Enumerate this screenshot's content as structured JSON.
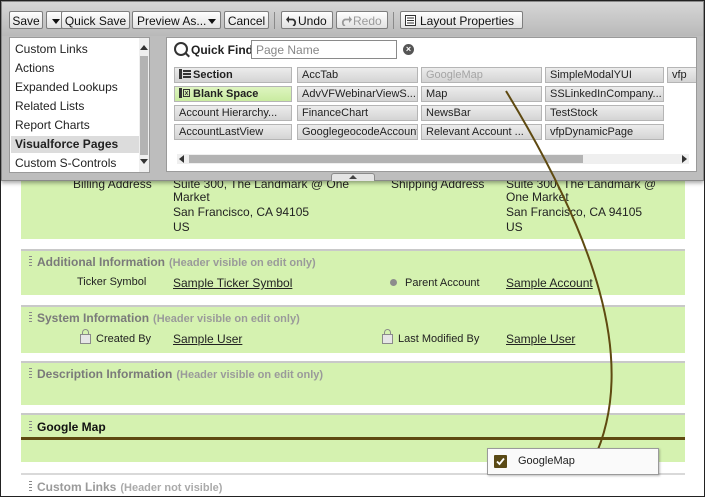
{
  "toolbar": {
    "save": "Save",
    "quick_save": "Quick Save",
    "preview_as": "Preview As...",
    "cancel": "Cancel",
    "undo": "Undo",
    "redo": "Redo",
    "layout_properties": "Layout Properties"
  },
  "categories": {
    "items": [
      "Custom Links",
      "Actions",
      "Expanded Lookups",
      "Related Lists",
      "Report Charts",
      "Visualforce Pages",
      "Custom S-Controls"
    ],
    "selected": "Visualforce Pages"
  },
  "quick_find": {
    "label": "Quick Find",
    "placeholder": "Page Name"
  },
  "palette_items": [
    [
      "Section",
      "AccTab",
      "GoogleMap",
      "SimpleModalYUI",
      "vfp"
    ],
    [
      "Blank Space",
      "AdvVFWebinarViewS...",
      "Map",
      "SSLinkedInCompany...",
      ""
    ],
    [
      "Account Hierarchy...",
      "FinanceChart",
      "NewsBar",
      "TestStock",
      ""
    ],
    [
      "AccountLastView",
      "GooglegeocodeAccount",
      "Relevant Account ...",
      "vfpDynamicPage",
      ""
    ]
  ],
  "address_block": {
    "partial_label_left": "Billing Address",
    "partial_value_left": "Suite 300, The Landmark @ One",
    "partial_label_right": "Shipping Address",
    "partial_value_right": "Suite 300, The Landmark @",
    "left_lines": [
      "Market",
      "San Francisco, CA 94105",
      "US"
    ],
    "right_lines": [
      "One Market",
      "San Francisco, CA 94105",
      "US"
    ]
  },
  "sections": {
    "additional": {
      "title": "Additional Information",
      "note": "(Header visible on edit only)"
    },
    "system": {
      "title": "System Information",
      "note": "(Header visible on edit only)"
    },
    "description": {
      "title": "Description Information",
      "note": "(Header visible on edit only)"
    },
    "google_map": {
      "title": "Google Map"
    },
    "custom_links": {
      "title": "Custom Links",
      "note": "(Header not visible)"
    }
  },
  "fields": {
    "ticker_symbol_label": "Ticker Symbol",
    "ticker_symbol_value": "Sample Ticker Symbol",
    "parent_account_label": "Parent Account",
    "parent_account_value": "Sample Account",
    "created_by_label": "Created By",
    "created_by_value": "Sample User",
    "last_modified_label": "Last Modified By",
    "last_modified_value": "Sample User"
  },
  "drag_item": {
    "label": "GoogleMap"
  },
  "colors": {
    "section_bg": "#d5f2b0",
    "drop_indicator": "#5f4a11",
    "palette_bg": "#bdbdbd"
  }
}
